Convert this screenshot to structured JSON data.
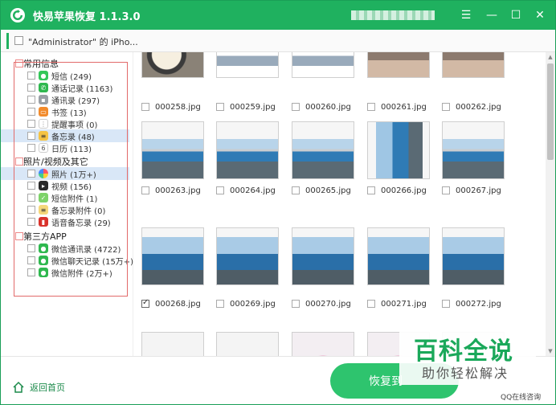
{
  "app": {
    "title": "快易苹果恢复 1.1.3.0",
    "brand_color": "#1fb15f",
    "buttons": {
      "menu": "☰",
      "minimize": "—",
      "maximize": "☐",
      "close": "✕"
    }
  },
  "device": {
    "name": "\"Administrator\" 的 iPho..."
  },
  "sidebar": {
    "categories": [
      {
        "label": "常用信息"
      },
      {
        "label": "照片/视频及其它"
      },
      {
        "label": "第三方APP"
      }
    ],
    "items": [
      {
        "label": "短信 (249)",
        "icon": "message-icon",
        "color": "#34c759"
      },
      {
        "label": "通话记录 (1163)",
        "icon": "phone-icon",
        "color": "#2fb84f"
      },
      {
        "label": "通讯录 (297)",
        "icon": "contacts-icon",
        "color": "#9aa0a6"
      },
      {
        "label": "书签 (13)",
        "icon": "bookmark-icon",
        "color": "#f28b2c"
      },
      {
        "label": "提醒事项 (0)",
        "icon": "reminder-icon",
        "color": "#ffffff"
      },
      {
        "label": "备忘录 (48)",
        "icon": "notes-icon",
        "color": "#f5c343"
      },
      {
        "label": "日历 (113)",
        "icon": "calendar-icon",
        "color": "#ffffff"
      },
      {
        "label": "照片 (1万+)",
        "icon": "photos-icon",
        "color": "#f0a0c0"
      },
      {
        "label": "视频 (156)",
        "icon": "video-icon",
        "color": "#2a2a2a"
      },
      {
        "label": "短信附件 (1)",
        "icon": "sms-attachment-icon",
        "color": "#7ed36a"
      },
      {
        "label": "备忘录附件 (0)",
        "icon": "notes-attachment-icon",
        "color": "#f5d77a"
      },
      {
        "label": "语音备忘录 (29)",
        "icon": "voice-memo-icon",
        "color": "#d9322b"
      },
      {
        "label": "微信通讯录 (4722)",
        "icon": "wechat-contacts-icon",
        "color": "#2fb84f"
      },
      {
        "label": "微信聊天记录 (15万+)",
        "icon": "wechat-chat-icon",
        "color": "#2fb84f"
      },
      {
        "label": "微信附件 (2万+)",
        "icon": "wechat-attachment-icon",
        "color": "#2fb84f"
      }
    ]
  },
  "photos": {
    "files": [
      "000258.jpg",
      "000259.jpg",
      "000260.jpg",
      "000261.jpg",
      "000262.jpg",
      "000263.jpg",
      "000264.jpg",
      "000265.jpg",
      "000266.jpg",
      "000267.jpg",
      "000268.jpg",
      "000269.jpg",
      "000270.jpg",
      "000271.jpg",
      "000272.jpg"
    ],
    "checked_file": "000268.jpg"
  },
  "footer": {
    "home": "返回首页",
    "recover": "恢复到"
  },
  "watermark": {
    "title": "百科全说",
    "subtitle": "助你轻松解决",
    "qq": "QQ在线咨询"
  }
}
